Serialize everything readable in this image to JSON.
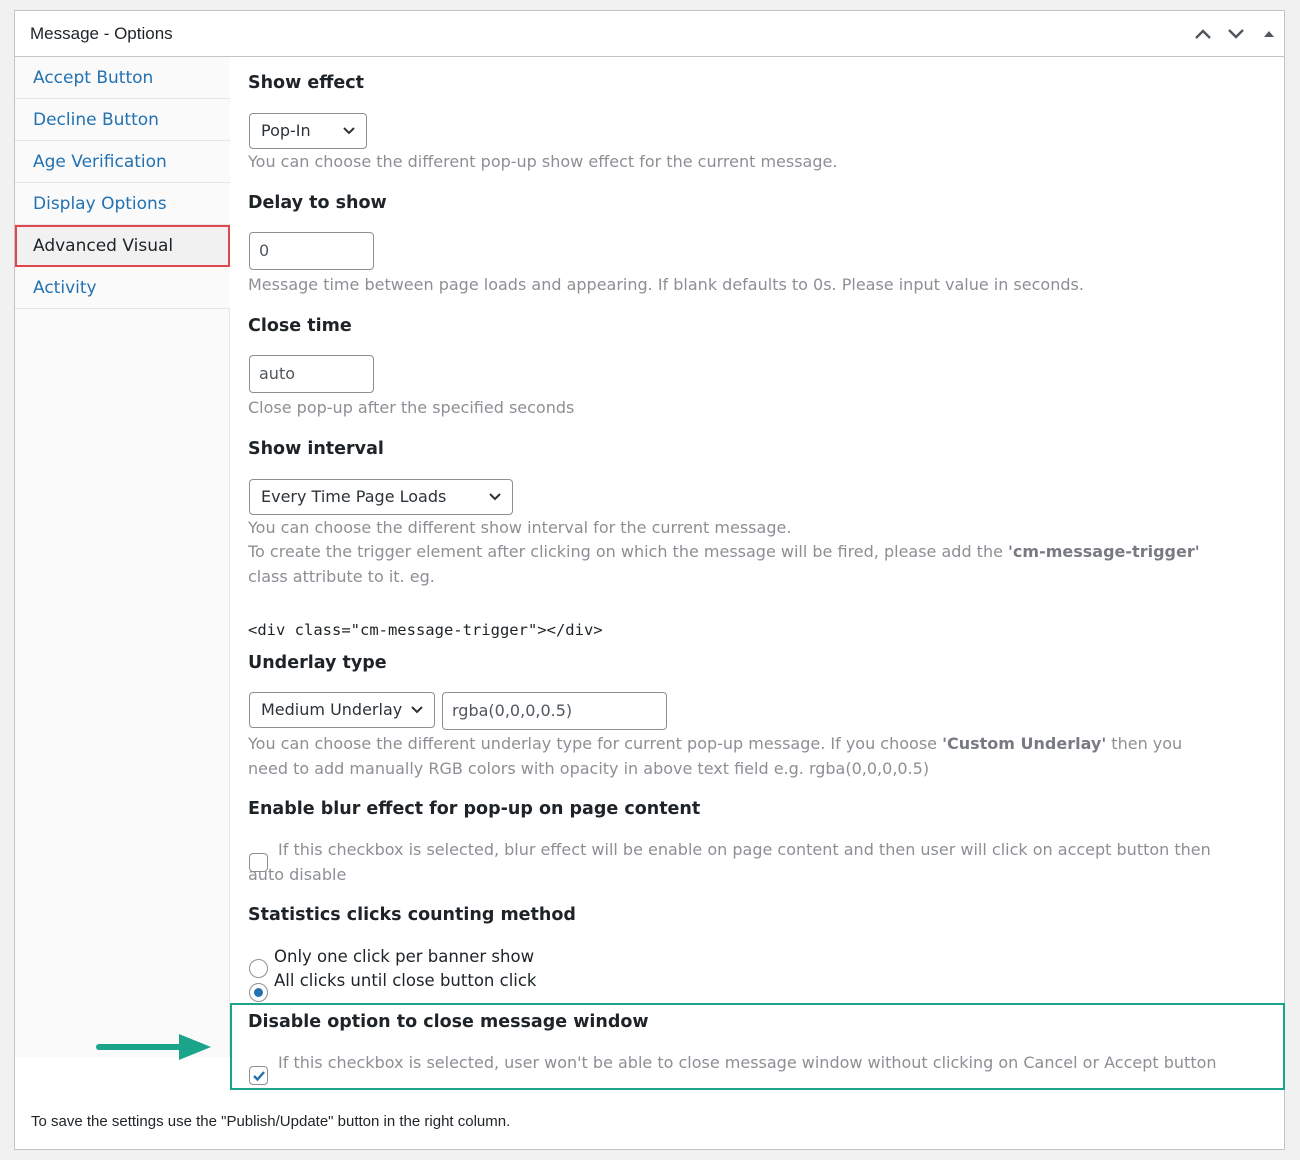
{
  "panel": {
    "title": "Message - Options",
    "controls": [
      "chevron-up-icon",
      "chevron-down-icon",
      "triangle-up-icon"
    ]
  },
  "sidebar": {
    "items": [
      {
        "label": "Accept Button",
        "active": false
      },
      {
        "label": "Decline Button",
        "active": false
      },
      {
        "label": "Age Verification",
        "active": false
      },
      {
        "label": "Display Options",
        "active": false
      },
      {
        "label": "Advanced Visual",
        "active": true
      },
      {
        "label": "Activity",
        "active": false
      }
    ]
  },
  "show_effect": {
    "heading": "Show effect",
    "value": "Pop-In",
    "desc": "You can choose the different pop-up show effect for the current message."
  },
  "delay": {
    "heading": "Delay to show",
    "value": "0",
    "desc": "Message time between page loads and appearing. If blank defaults to 0s. Please input value in seconds."
  },
  "close_time": {
    "heading": "Close time",
    "value": "auto",
    "desc": "Close pop-up after the specified seconds"
  },
  "show_interval": {
    "heading": "Show interval",
    "value": "Every Time Page Loads",
    "desc1": "You can choose the different show interval for the current message.",
    "desc2_pre": "To create the trigger element after clicking on which the message will be fired, please add the ",
    "desc2_bold": "'cm-message-trigger'",
    "desc3": "class attribute to it. eg.",
    "code": "<div class=\"cm-message-trigger\"></div>"
  },
  "underlay": {
    "heading": "Underlay type",
    "value": "Medium Underlay",
    "color_value": "rgba(0,0,0,0.5)",
    "desc1_pre": "You can choose the different underlay type for current pop-up message. If you choose ",
    "desc1_bold": "'Custom Underlay'",
    "desc1_post": " then you",
    "desc2": "need to add manually RGB colors with opacity in above text field e.g. rgba(0,0,0,0.5)"
  },
  "blur": {
    "heading": "Enable blur effect for pop-up on page content",
    "checked": false,
    "desc1": "If this checkbox is selected, blur effect will be enable on page content and then user will click on accept button then",
    "desc2": "auto disable"
  },
  "stats": {
    "heading": "Statistics clicks counting method",
    "options": [
      {
        "label": "Only one click per banner show",
        "selected": false
      },
      {
        "label": "All clicks until close button click",
        "selected": true
      }
    ]
  },
  "disable_close": {
    "heading": "Disable option to close message window",
    "checked": true,
    "desc": "If this checkbox is selected, user won't be able to close message window without clicking on Cancel or Accept button"
  },
  "footer": {
    "note": "To save the settings use the \"Publish/Update\" button in the right column."
  },
  "colors": {
    "link": "#2271b1",
    "active_border": "#e0474c",
    "highlight": "#1aa58a"
  }
}
